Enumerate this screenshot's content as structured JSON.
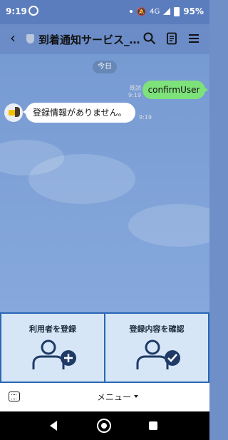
{
  "status_bar": {
    "time": "9:19",
    "network": "4G",
    "battery": "95%"
  },
  "header": {
    "title": "到着通知サービス_…"
  },
  "chat": {
    "date_label": "今日",
    "read_label": "既読",
    "outgoing_time": "9:19",
    "outgoing_message": "confirmUser",
    "incoming_message": "登録情報がありません。",
    "incoming_time": "9:19"
  },
  "rich_menu": {
    "left_label": "利用者を登録",
    "right_label": "登録内容を確認"
  },
  "bottom_bar": {
    "menu_label": "メニュー"
  },
  "colors": {
    "header": "#6b8cc7",
    "chat_bg": "#7ea1d7",
    "outgoing_bubble": "#7ee27a",
    "rich_menu_border": "#2a67b4",
    "rich_menu_cell": "#d6e6f6",
    "icon_navy": "#1f3a66"
  },
  "icons": {
    "back": "back-arrow-icon",
    "shield": "shield-icon",
    "search": "search-icon",
    "memo": "notes-icon",
    "menu": "hamburger-menu-icon",
    "add_user": "add-user-icon",
    "check_user": "check-user-icon",
    "keyboard": "keyboard-icon"
  }
}
